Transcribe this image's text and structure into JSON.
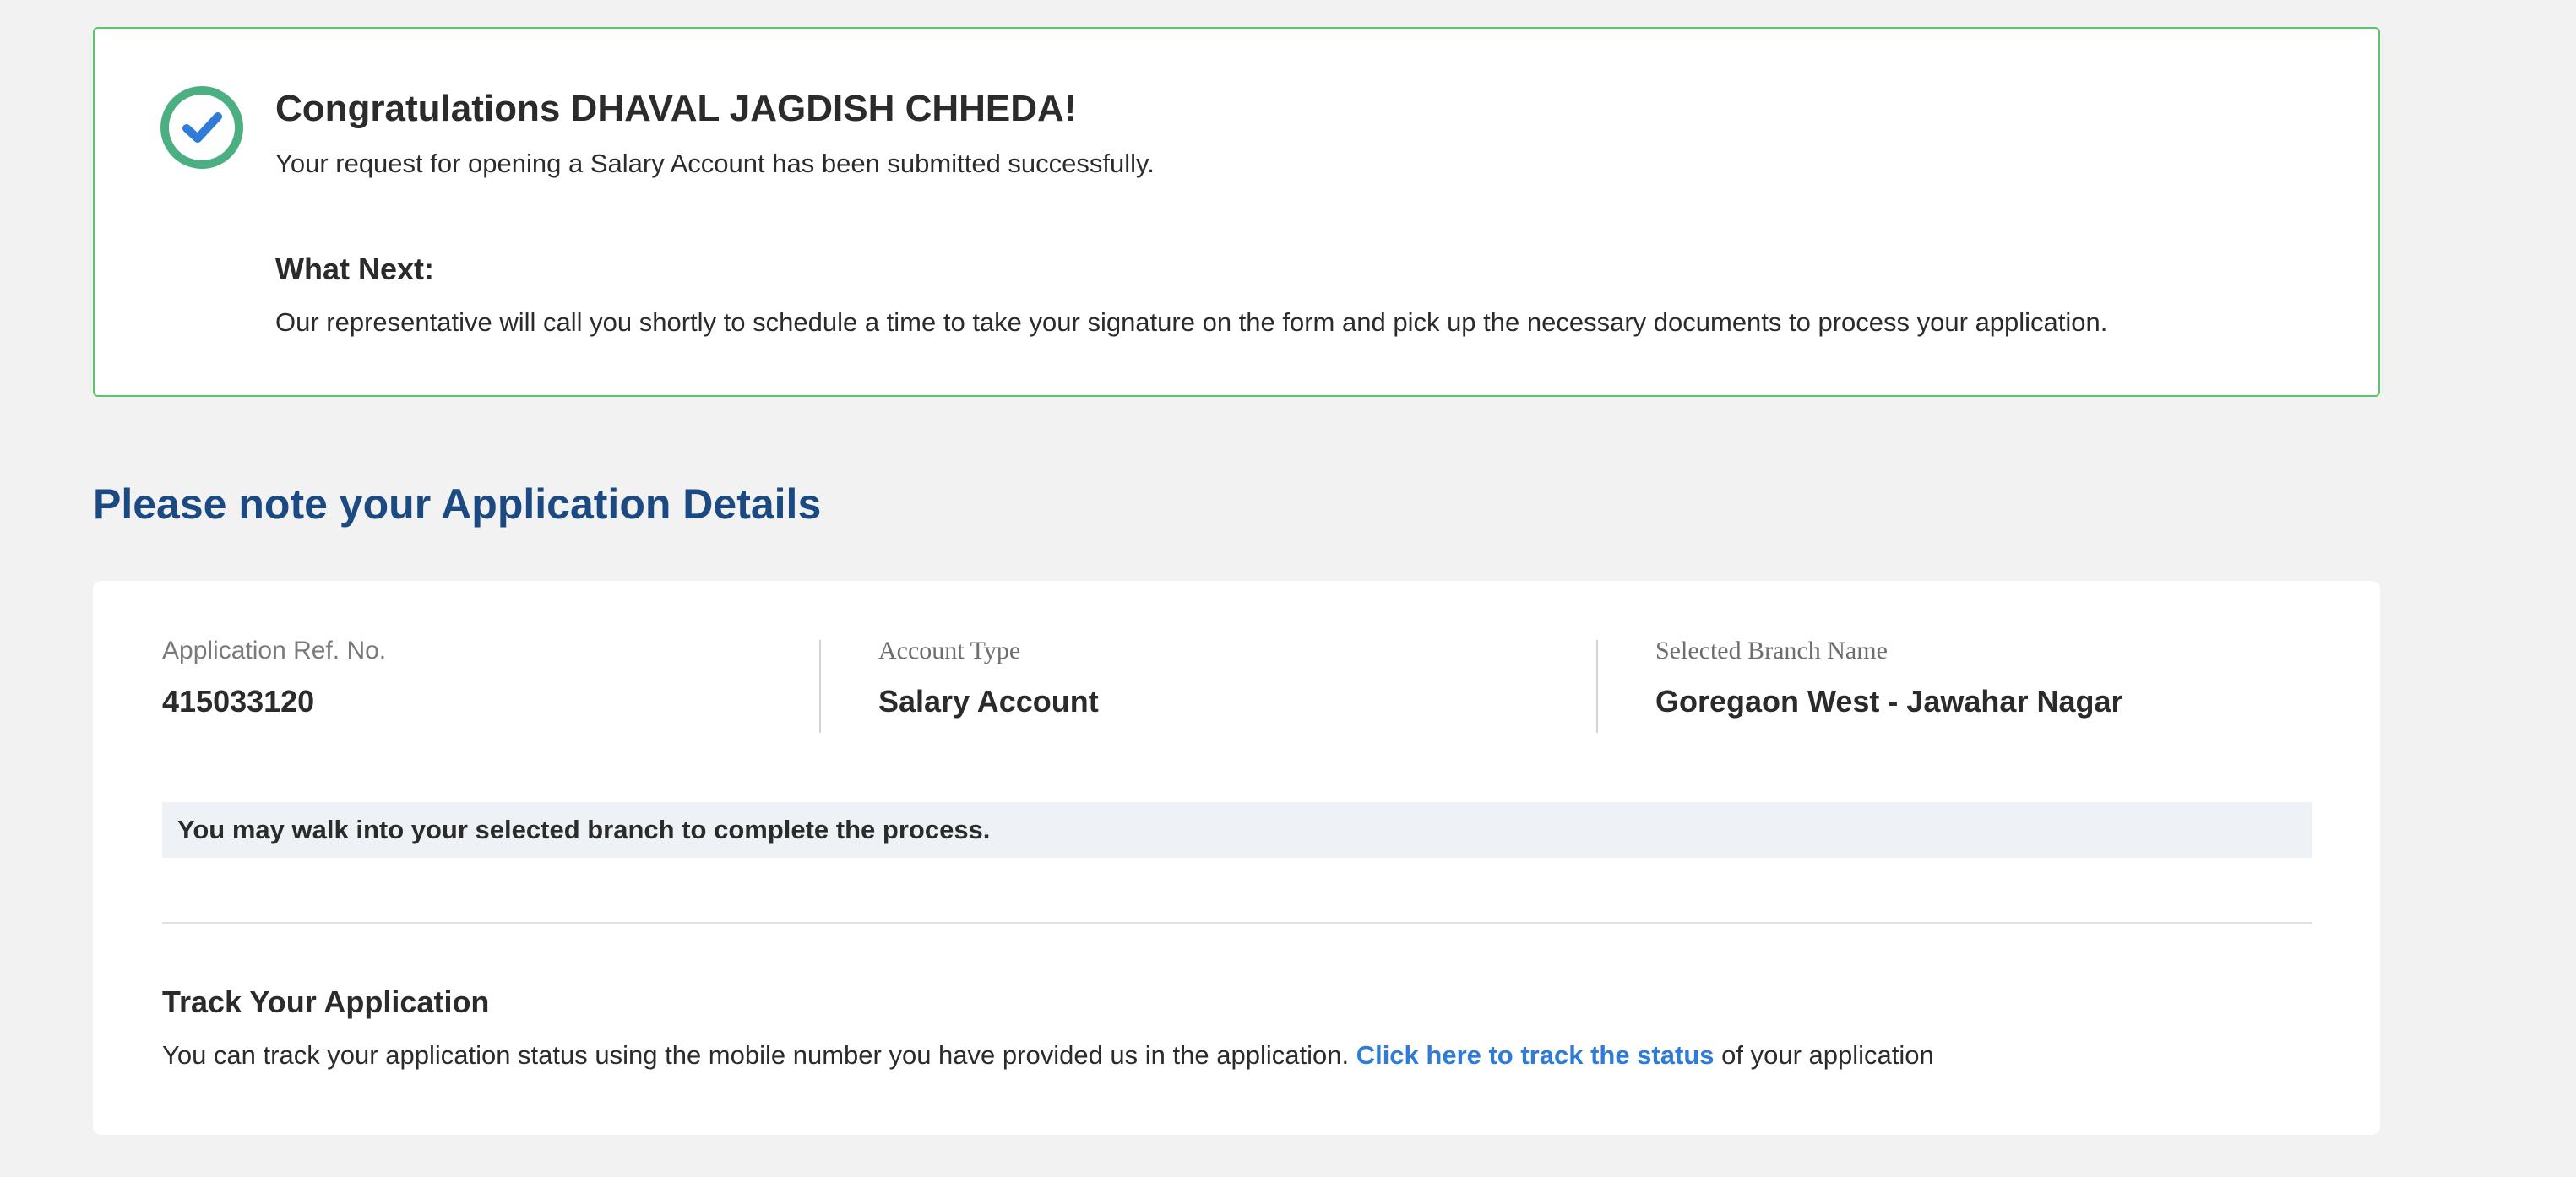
{
  "success": {
    "title": "Congratulations DHAVAL JAGDISH CHHEDA!",
    "message": "Your request for opening a Salary Account has been submitted successfully.",
    "next_heading": "What Next:",
    "next_body": "Our representative will call you shortly to schedule a time to take your signature on the form and pick up the necessary documents to process your application.",
    "icon": "check-circle-icon",
    "ring_color": "#4caf82",
    "check_color": "#2f7bd8"
  },
  "details": {
    "heading": "Please note your Application Details",
    "ref_label": "Application Ref. No.",
    "ref_value": "415033120",
    "account_type_label": "Account Type",
    "account_type_value": "Salary Account",
    "branch_label": "Selected Branch Name",
    "branch_value": "Goregaon West - Jawahar Nagar",
    "walk_in_note": "You may walk into your selected branch to complete the process."
  },
  "track": {
    "heading": "Track Your Application",
    "body_before": "You can track your application status using the mobile number you have provided us in the application.",
    "link_text": "Click here to track the status",
    "body_after": "of your application",
    "link_color": "#2f7bd8"
  },
  "colors": {
    "heading_blue": "#1b4a82",
    "success_border": "#5cc46a",
    "background": "#f2f2f2"
  }
}
